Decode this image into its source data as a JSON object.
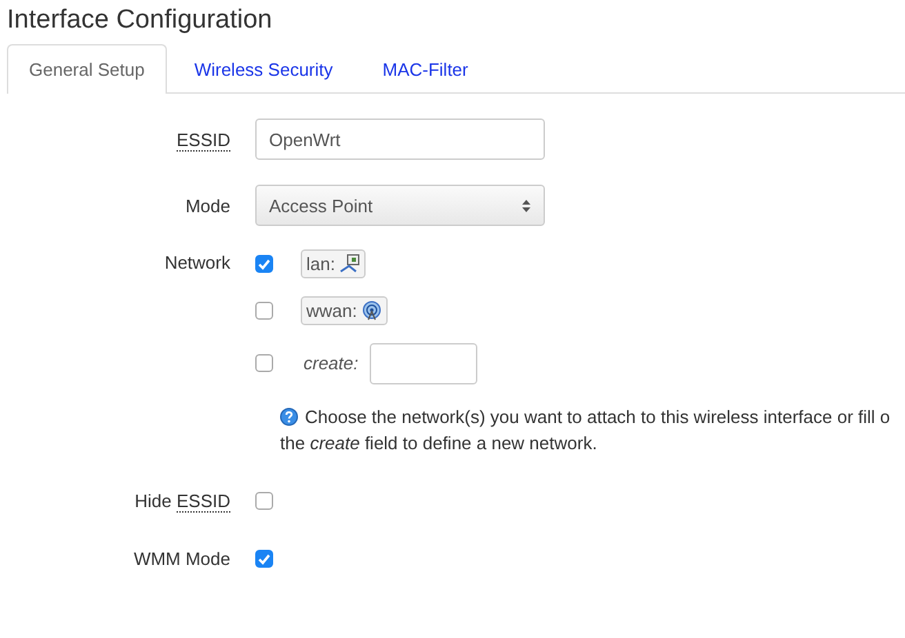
{
  "title": "Interface Configuration",
  "tabs": [
    {
      "label": "General Setup",
      "selected": true
    },
    {
      "label": "Wireless Security",
      "selected": false
    },
    {
      "label": "MAC-Filter",
      "selected": false
    }
  ],
  "essid": {
    "label": "ESSID",
    "value": "OpenWrt"
  },
  "mode": {
    "label": "Mode",
    "value": "Access Point"
  },
  "network": {
    "label": "Network",
    "options": [
      {
        "kind": "iface",
        "name": "lan:",
        "checked": true
      },
      {
        "kind": "iface",
        "name": "wwan:",
        "checked": false
      },
      {
        "kind": "create",
        "name": "create:",
        "checked": false
      }
    ],
    "help": [
      "Choose the network(s) you want to attach to this wireless interface or fill o",
      "the *create* field to define a new network."
    ]
  },
  "hide_essid": {
    "label_prefix": "Hide ",
    "label_abbr": "ESSID",
    "checked": false
  },
  "wmm": {
    "label": "WMM Mode",
    "checked": true
  }
}
